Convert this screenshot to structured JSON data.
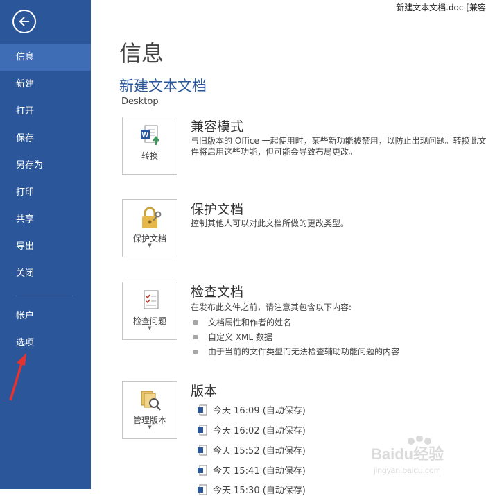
{
  "window": {
    "title": "新建文本文档.doc [兼容"
  },
  "sidebar": {
    "items": [
      {
        "label": "信息"
      },
      {
        "label": "新建"
      },
      {
        "label": "打开"
      },
      {
        "label": "保存"
      },
      {
        "label": "另存为"
      },
      {
        "label": "打印"
      },
      {
        "label": "共享"
      },
      {
        "label": "导出"
      },
      {
        "label": "关闭"
      },
      {
        "label": "帐户"
      },
      {
        "label": "选项"
      }
    ],
    "active_index": 0
  },
  "main": {
    "page_title": "信息",
    "doc_name": "新建文本文档",
    "doc_path": "Desktop",
    "compat": {
      "button_label": "转换",
      "title": "兼容模式",
      "desc": "与旧版本的 Office 一起使用时，某些新功能被禁用，以防止出现问题。转换此文件将启用这些功能，但可能会导致布局更改。"
    },
    "protect": {
      "button_label": "保护文档",
      "title": "保护文档",
      "desc": "控制其他人可以对此文档所做的更改类型。"
    },
    "inspect": {
      "button_label": "检查问题",
      "title": "检查文档",
      "desc": "在发布此文件之前，请注意其包含以下内容:",
      "bullets": [
        "文档属性和作者的姓名",
        "自定义 XML 数据",
        "由于当前的文件类型而无法检查辅助功能问题的内容"
      ]
    },
    "versions": {
      "button_label": "管理版本",
      "title": "版本",
      "rows": [
        "今天 16:09 (自动保存)",
        "今天 16:02 (自动保存)",
        "今天 15:52 (自动保存)",
        "今天 15:41 (自动保存)",
        "今天 15:30 (自动保存)"
      ]
    }
  },
  "watermark": {
    "text1": "Baidu经验",
    "text2": "jingyan.baidu.com"
  },
  "colors": {
    "sidebar": "#2b579a",
    "active": "#3e6db5",
    "accent": "#2b579a",
    "annotation": "#e8322f"
  }
}
